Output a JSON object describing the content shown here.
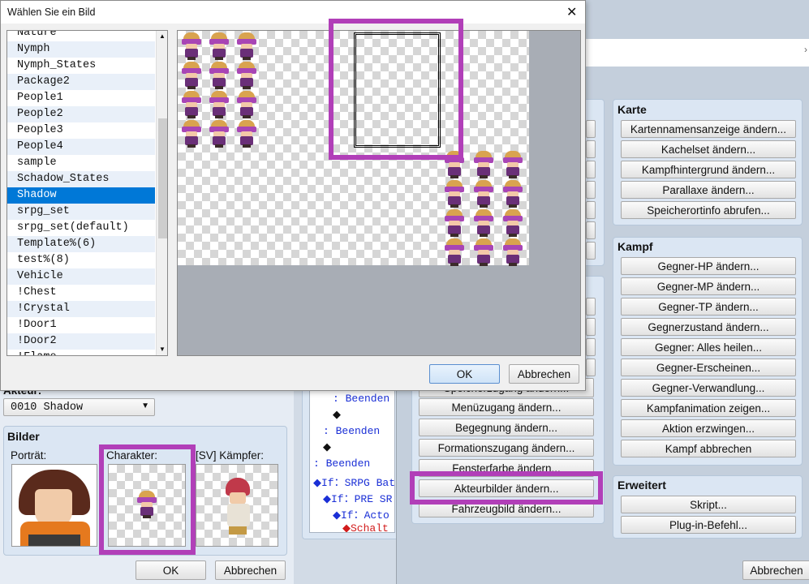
{
  "dialog": {
    "title": "Wählen Sie ein Bild",
    "close_icon": "✕",
    "ok": "OK",
    "cancel": "Abbrechen",
    "files": [
      "Nature",
      "Nymph",
      "Nymph_States",
      "Package2",
      "People1",
      "People2",
      "People3",
      "People4",
      "sample",
      "Schadow_States",
      "Shadow",
      "srpg_set",
      "srpg_set(default)",
      "Template%(6)",
      "test%(8)",
      "Vehicle",
      "!Chest",
      "!Crystal",
      "!Door1",
      "!Door2",
      "!Flame"
    ],
    "selected": "Shadow"
  },
  "actor": {
    "label": "Akteur:",
    "value": "0010 Shadow"
  },
  "images": {
    "title": "Bilder",
    "portrait": "Porträt:",
    "character": "Charakter:",
    "battler": "[SV] Kämpfer:",
    "ok": "OK",
    "cancel": "Abbrechen"
  },
  "tree": {
    "rows": [
      {
        "indent": 1,
        "text": ": Beenden",
        "type": "blue"
      },
      {
        "indent": 1,
        "text": "◆",
        "type": "black"
      },
      {
        "indent": 0.5,
        "text": ": Beenden",
        "type": "blue"
      },
      {
        "indent": 0.5,
        "text": "◆",
        "type": "black"
      },
      {
        "indent": 0,
        "text": ": Beenden",
        "type": "blue"
      },
      {
        "indent": 0,
        "text": "◆If：SRPG Bat",
        "type": "blue"
      },
      {
        "indent": 0.5,
        "text": "◆If：PRE SR",
        "type": "blue"
      },
      {
        "indent": 1,
        "text": "◆If：Acto",
        "type": "blue"
      },
      {
        "indent": 1.5,
        "text": "◆Schalt",
        "type": "red"
      }
    ]
  },
  "commands_middle": {
    "partial_top": "Speicherzugang ändern...",
    "items": [
      "Menüzugang ändern...",
      "Begegnung ändern...",
      "Formationszugang ändern...",
      "Fensterfarbe ändern...",
      "Akteurbilder ändern...",
      "Fahrzeugbild ändern..."
    ]
  },
  "karte": {
    "title": "Karte",
    "items": [
      "Kartennamensanzeige ändern...",
      "Kachelset ändern...",
      "Kampfhintergrund ändern...",
      "Parallaxe ändern...",
      "Speicherortinfo abrufen..."
    ]
  },
  "kampf": {
    "title": "Kampf",
    "items": [
      "Gegner-HP ändern...",
      "Gegner-MP ändern...",
      "Gegner-TP ändern...",
      "Gegnerzustand ändern...",
      "Gegner: Alles heilen...",
      "Gegner-Erscheinen...",
      "Gegner-Verwandlung...",
      "Kampfanimation zeigen...",
      "Aktion erzwingen...",
      "Kampf abbrechen"
    ]
  },
  "erweitert": {
    "title": "Erweitert",
    "items": [
      "Skript...",
      "Plug-in-Befehl..."
    ]
  },
  "event_window": {
    "cancel": "Abbrechen"
  },
  "colors": {
    "highlight": "#b13fb8",
    "selection": "#0078d7"
  }
}
